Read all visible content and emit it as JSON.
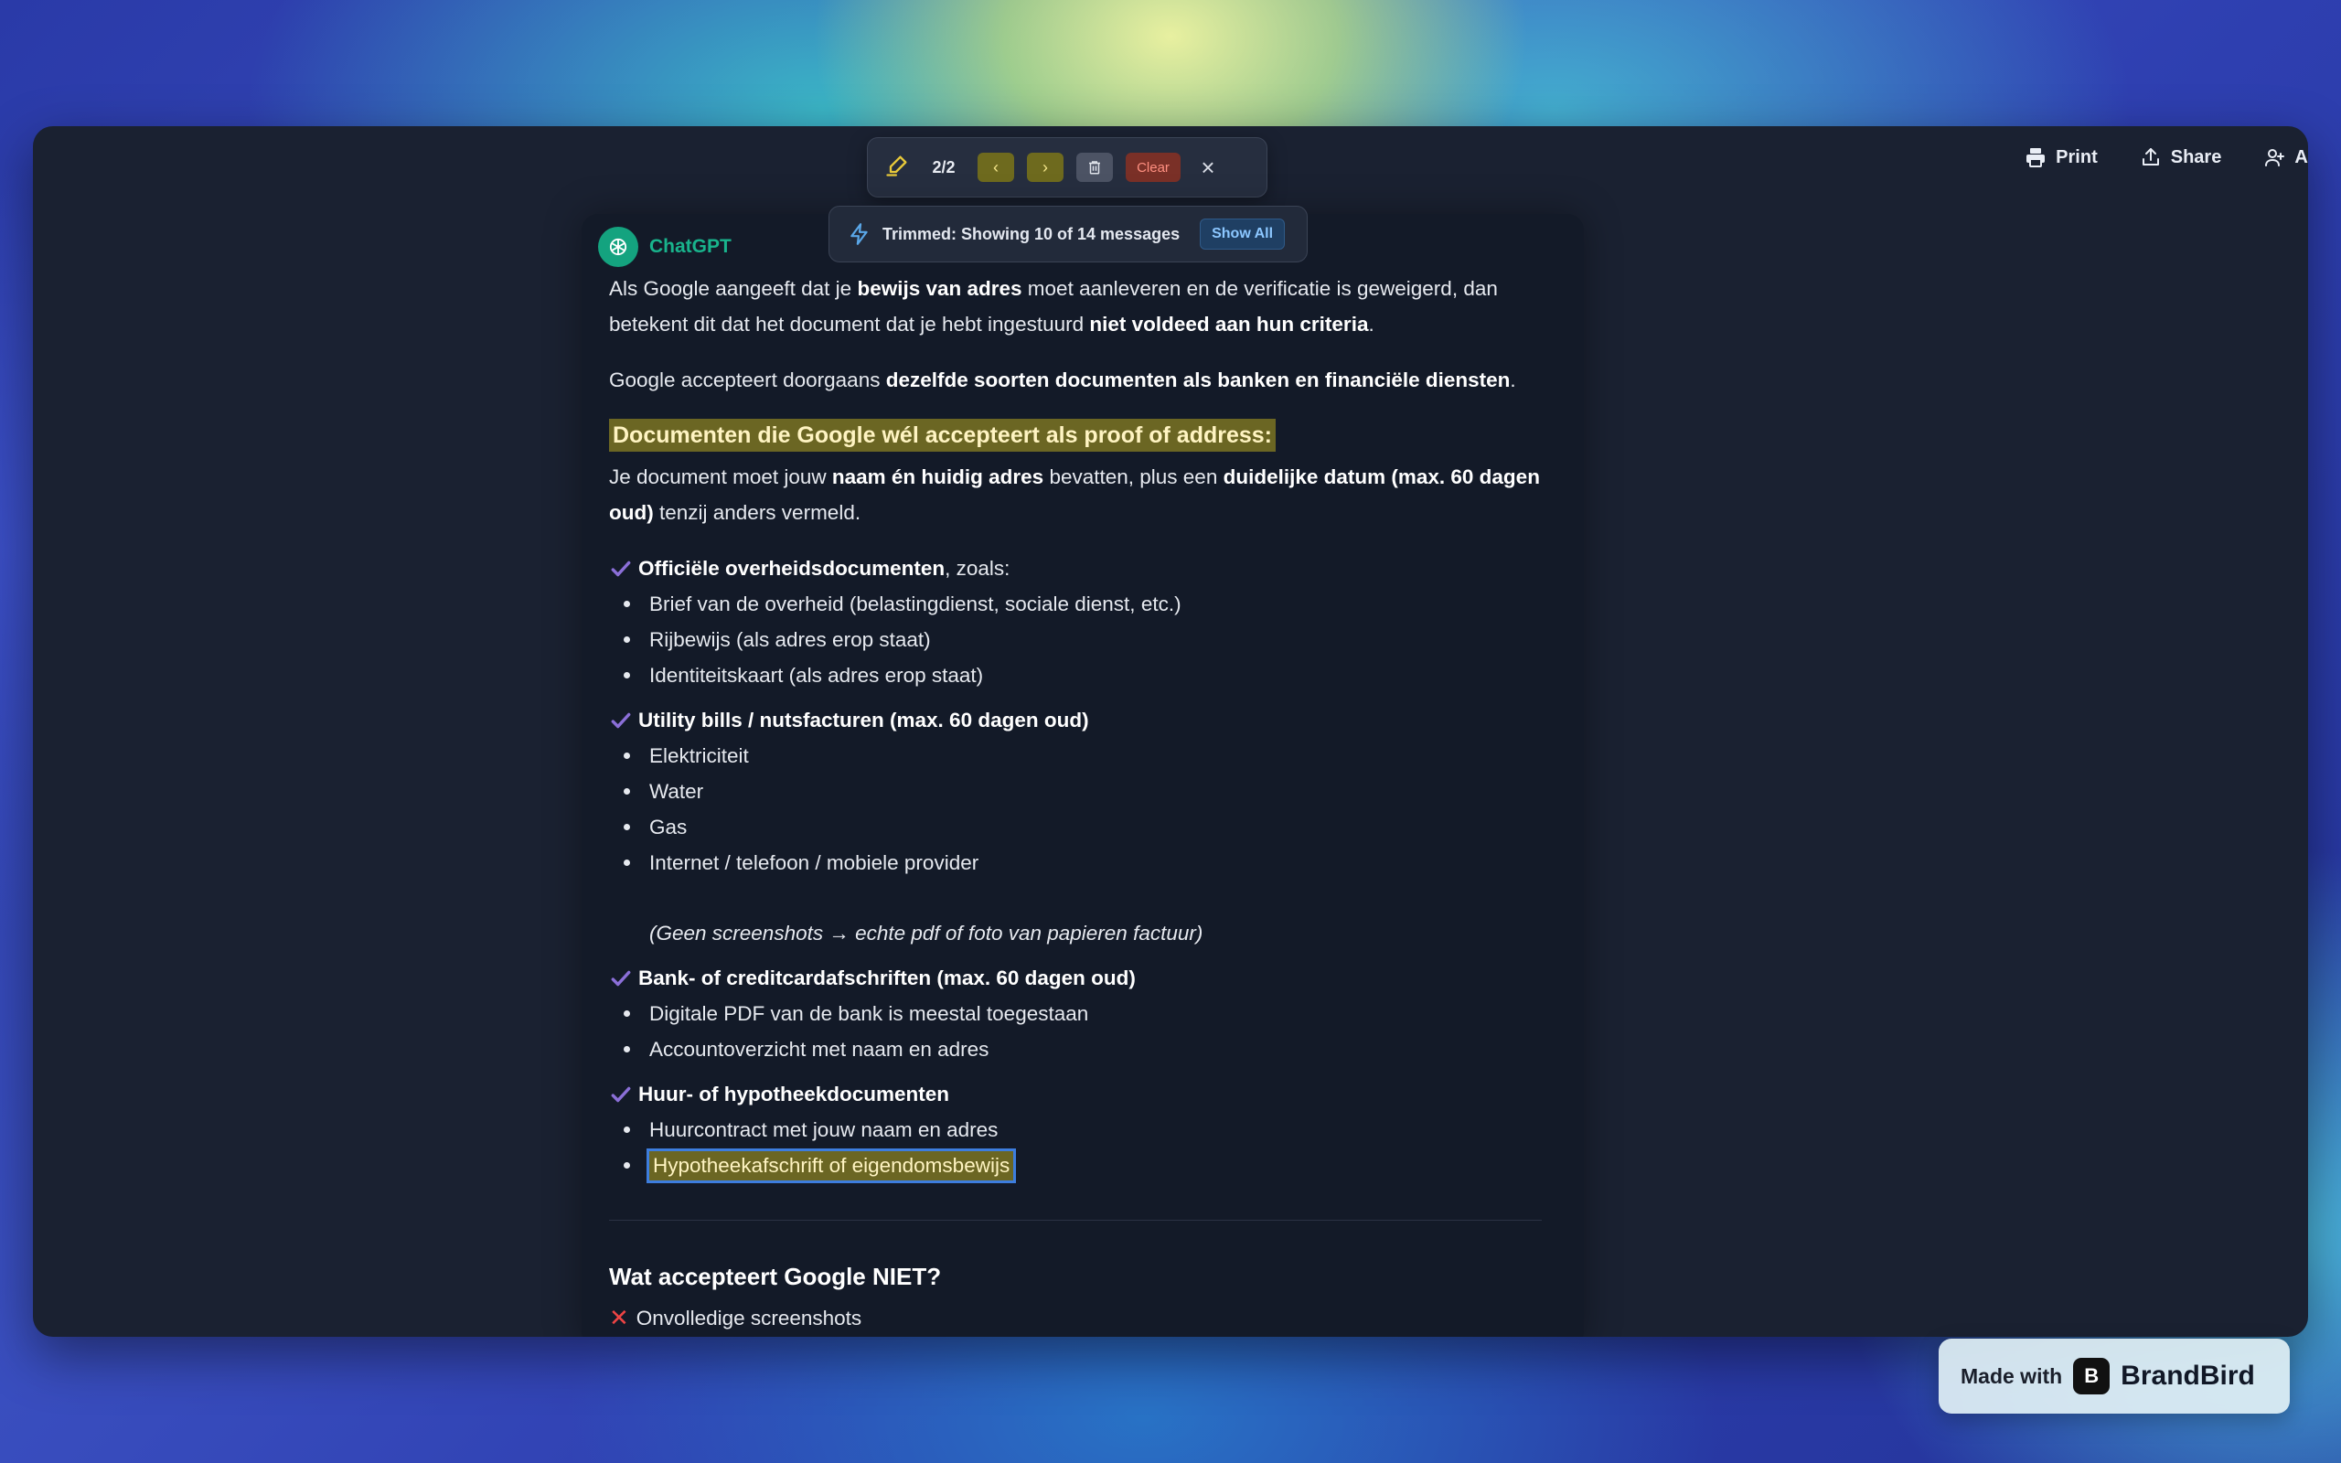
{
  "topbar": {
    "actions": [
      {
        "label": "Print",
        "icon": "printer-icon"
      },
      {
        "label": "Share",
        "icon": "share-icon"
      },
      {
        "label": "Ad",
        "icon": "user-add-icon"
      }
    ]
  },
  "highlight_toolbar": {
    "count": "2/2",
    "clear_label": "Clear"
  },
  "trim_notice": {
    "text": "Trimmed: Showing 10 of 14 messages",
    "button_label": "Show All"
  },
  "message": {
    "author": "ChatGPT",
    "p1": {
      "t1": "Als Google aangeeft dat je ",
      "b1": "bewijs van adres",
      "t2": " moet aanleveren en de verificatie is geweigerd, dan betekent dit dat het document dat je hebt ingestuurd ",
      "b2": "niet voldeed aan hun criteria",
      "t3": "."
    },
    "p2": {
      "t1": "Google accepteert doorgaans ",
      "b1": "dezelfde soorten documenten als banken en financiële diensten",
      "t2": "."
    },
    "heading": "Documenten die Google wél accepteert als proof of address:",
    "p3": {
      "t1": "Je document moet jouw ",
      "b1": "naam én huidig adres",
      "t2": " bevatten, plus een ",
      "b2": "duidelijke datum (max. 60 dagen oud)",
      "t3": " tenzij anders vermeld."
    },
    "sections": [
      {
        "title": "Officiële overheidsdocumenten",
        "title_suffix": ", zoals:",
        "items": [
          "Brief van de overheid (belastingdienst, sociale dienst, etc.)",
          "Rijbewijs (als adres erop staat)",
          "Identiteitskaart (als adres erop staat)"
        ]
      },
      {
        "title": "Utility bills / nutsfacturen (max. 60 dagen oud)",
        "title_suffix": "",
        "items": [
          "Elektriciteit",
          "Water",
          "Gas",
          "Internet / telefoon / mobiele provider"
        ],
        "note": "(Geen screenshots → echte pdf of foto van papieren factuur)"
      },
      {
        "title": "Bank- of creditcardafschriften (max. 60 dagen oud)",
        "title_suffix": "",
        "items": [
          "Digitale PDF van de bank is meestal toegestaan",
          "Accountoverzicht met naam en adres"
        ]
      },
      {
        "title": "Huur- of hypotheekdocumenten",
        "title_suffix": "",
        "items": [
          "Huurcontract met jouw naam en adres",
          "Hypotheekafschrift of eigendomsbewijs"
        ]
      }
    ],
    "not_heading": "Wat accepteert Google NIET?",
    "not_items": [
      "Onvolledige screenshots"
    ]
  },
  "brand_badge": {
    "made_with": "Made with",
    "logo_glyph": "B",
    "brand_name": "BrandBird"
  },
  "colors": {
    "accent_green": "#19b38c",
    "highlight_bg": "#6b6623",
    "check_purple": "#8b6fd8",
    "x_red": "#ef4444"
  }
}
